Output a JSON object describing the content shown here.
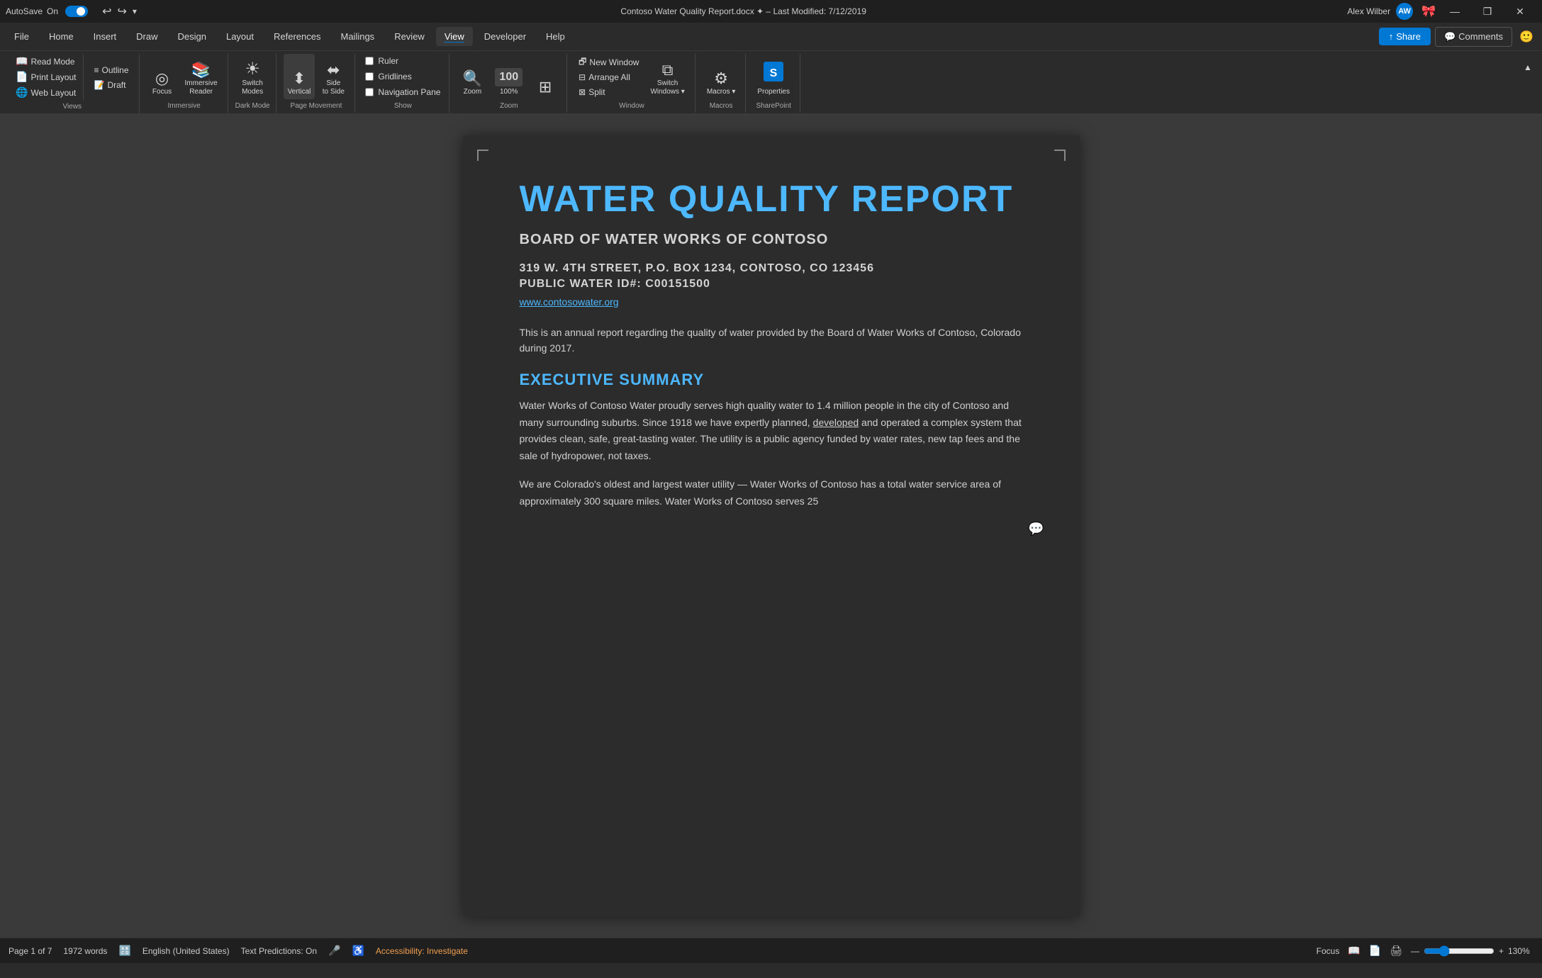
{
  "titleBar": {
    "autosave": "AutoSave",
    "toggleState": "On",
    "docTitle": "Contoso Water Quality Report.docx  ✦  –  Last Modified: 7/12/2019",
    "userName": "Alex Wilber",
    "userInitials": "AW",
    "undoIcon": "↩",
    "redoIcon": "↪",
    "minimize": "—",
    "restore": "❐",
    "close": "✕"
  },
  "menuBar": {
    "items": [
      "File",
      "Home",
      "Insert",
      "Draw",
      "Design",
      "Layout",
      "References",
      "Mailings",
      "Review",
      "View",
      "Developer",
      "Help"
    ],
    "activeItem": "View",
    "shareLabel": "Share",
    "commentsLabel": "Comments"
  },
  "ribbon": {
    "groups": {
      "views": {
        "label": "Views",
        "buttons": [
          {
            "id": "read-mode",
            "label": "Read\nMode",
            "icon": "📖"
          },
          {
            "id": "print-layout",
            "label": "Print\nLayout",
            "icon": "📄"
          },
          {
            "id": "web-layout",
            "label": "Web\nLayout",
            "icon": "🌐"
          }
        ],
        "smallButtons": [
          {
            "id": "outline",
            "label": "Outline",
            "icon": "≡"
          },
          {
            "id": "draft",
            "label": "Draft",
            "icon": "📝"
          }
        ]
      },
      "immersive": {
        "label": "Immersive",
        "buttons": [
          {
            "id": "focus",
            "label": "Focus",
            "icon": "◎"
          },
          {
            "id": "immersive-reader",
            "label": "Immersive\nReader",
            "icon": "📚"
          }
        ]
      },
      "darkMode": {
        "label": "Dark Mode",
        "buttons": [
          {
            "id": "switch-modes",
            "label": "Switch\nModes",
            "icon": "☀"
          }
        ]
      },
      "pageMovement": {
        "label": "Page Movement",
        "buttons": [
          {
            "id": "vertical",
            "label": "Vertical",
            "icon": "⬍",
            "active": true
          },
          {
            "id": "side-to-side",
            "label": "Side\nto Side",
            "icon": "⬌"
          }
        ]
      },
      "show": {
        "label": "Show",
        "checkboxes": [
          {
            "id": "ruler",
            "label": "Ruler",
            "checked": false
          },
          {
            "id": "gridlines",
            "label": "Gridlines",
            "checked": false
          },
          {
            "id": "navigation-pane",
            "label": "Navigation Pane",
            "checked": false
          }
        ]
      },
      "zoom": {
        "label": "Zoom",
        "buttons": [
          {
            "id": "zoom",
            "label": "Zoom",
            "icon": "🔍"
          },
          {
            "id": "zoom-100",
            "label": "100%",
            "icon": "100"
          },
          {
            "id": "zoom-pages",
            "label": "",
            "icon": "⊞"
          }
        ]
      },
      "window": {
        "label": "Window",
        "buttons": [
          {
            "id": "new-window",
            "label": "New Window",
            "icon": "🗗"
          },
          {
            "id": "arrange-all",
            "label": "Arrange All",
            "icon": "⊟"
          },
          {
            "id": "split",
            "label": "Split",
            "icon": "⊠"
          },
          {
            "id": "switch-windows",
            "label": "Switch\nWindows",
            "icon": "⧉"
          }
        ]
      },
      "macros": {
        "label": "Macros",
        "buttons": [
          {
            "id": "macros",
            "label": "Macros",
            "icon": "⚙"
          }
        ]
      },
      "sharepoint": {
        "label": "SharePoint",
        "buttons": [
          {
            "id": "properties",
            "label": "Properties",
            "icon": "🟦"
          }
        ]
      }
    }
  },
  "document": {
    "mainTitle": "WATER QUALITY REPORT",
    "subtitle": "BOARD OF WATER WORKS OF CONTOSO",
    "address1": "319 W. 4TH STREET, P.O. BOX 1234, CONTOSO, CO 123456",
    "address2": "PUBLIC WATER ID#: C00151500",
    "website": "www.contosowater.org",
    "intro": "This is an annual report regarding the quality of water provided by the Board of Water Works of Contoso, Colorado during 2017.",
    "execSummaryTitle": "EXECUTIVE SUMMARY",
    "execSummaryP1": "Water Works of Contoso Water proudly serves high quality water to 1.4 million people in the city of Contoso and many surrounding suburbs. Since 1918 we have expertly planned, developed and operated a complex system that provides clean, safe, great-tasting water. The utility is a public agency funded by water rates, new tap fees and the sale of hydropower, not taxes.",
    "execSummaryP2": "We are Colorado's oldest and largest water utility — Water Works of Contoso has a total water service area of approximately 300 square miles. Water Works of Contoso serves 25"
  },
  "statusBar": {
    "page": "Page 1 of 7",
    "words": "1972 words",
    "language": "English (United States)",
    "textPredictions": "Text Predictions: On",
    "accessibility": "Accessibility: Investigate",
    "focus": "Focus",
    "zoom": "130%",
    "readerIcon": "📖",
    "layoutIcon": "📄",
    "printIcon": "🖨"
  },
  "icons": {
    "autosave": "🔄",
    "undo": "↩",
    "redo": "↪",
    "share": "👤",
    "comments": "💬",
    "smiley": "🙂",
    "checkmark": "✓",
    "minimize": "—",
    "restore": "⧉",
    "close": "✕",
    "dropdown": "▾",
    "proofing": "🔠",
    "accessibility_icon": "♿",
    "page_view": "⊞",
    "collapse": "▲"
  },
  "colors": {
    "accent": "#0078d4",
    "titleColor": "#4db8ff",
    "background": "#2b2b2b",
    "pageBackground": "#2c2c2c",
    "statusBarBg": "#1f1f1f"
  }
}
